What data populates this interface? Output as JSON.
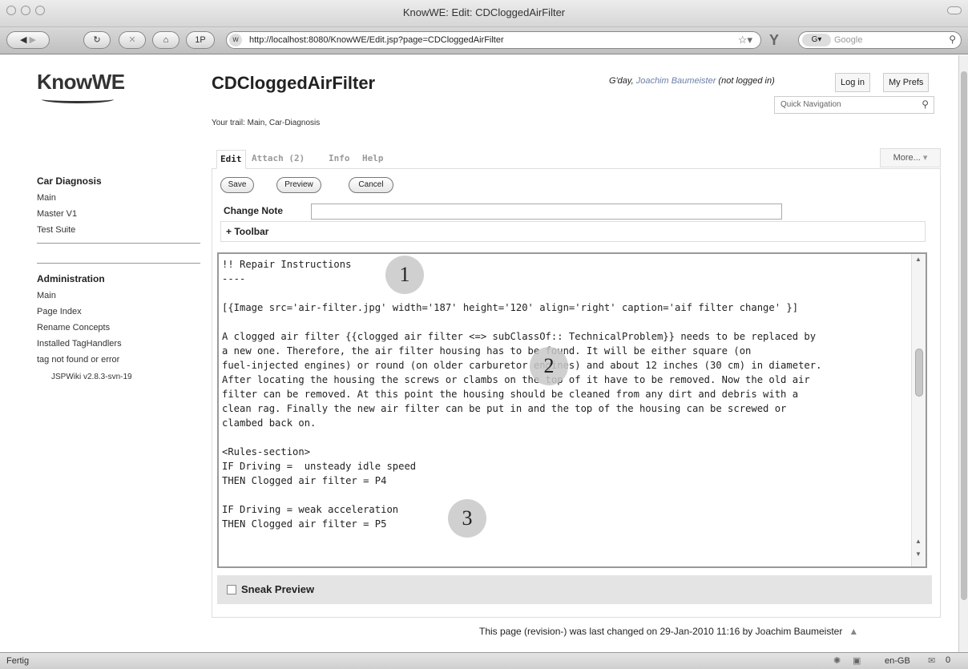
{
  "window": {
    "title": "KnowWE: Edit: CDCloggedAirFilter"
  },
  "browser": {
    "url": "http://localhost:8080/KnowWE/Edit.jsp?page=CDCloggedAirFilter",
    "search_placeholder": "Google",
    "onep_label": "1P",
    "back_icon": "back-arrow-icon",
    "reload_icon": "reload-icon",
    "stop_icon": "stop-icon",
    "home_icon": "home-icon"
  },
  "header": {
    "logo": "KnowWE",
    "page_title": "CDCloggedAirFilter",
    "trail": "Your trail: Main, Car-Diagnosis",
    "greeting_prefix": "G'day,",
    "user_name": "Joachim Baumeister",
    "greeting_suffix": "(not logged in)",
    "login_label": "Log in",
    "prefs_label": "My Prefs",
    "quick_nav_placeholder": "Quick Navigation"
  },
  "sidebar": {
    "section1_title": "Car Diagnosis",
    "section1_items": [
      "Main",
      "Master V1",
      "Test Suite"
    ],
    "section2_title": "Administration",
    "section2_items": [
      "Main",
      "Page Index",
      "Rename Concepts",
      "Installed TagHandlers",
      "tag not found or error"
    ],
    "version": "JSPWiki v2.8.3-svn-19"
  },
  "tabs": {
    "edit": "Edit",
    "attach": "Attach (2)",
    "info": "Info",
    "help": "Help",
    "more": "More..."
  },
  "edit_form": {
    "save_label": "Save",
    "preview_label": "Preview",
    "cancel_label": "Cancel",
    "change_note_label": "Change Note",
    "change_note_value": "",
    "toolbar_label": "+ Toolbar",
    "editor_lines": [
      "!! Repair Instructions",
      "----",
      "",
      "[{Image src='air-filter.jpg' width='187' height='120' align='right' caption='aif filter change' }]",
      "",
      "A clogged air filter {{clogged air filter <=> subClassOf:: TechnicalProblem}} needs to be replaced by",
      "a new one. Therefore, the air filter housing has to be found. It will be either square (on",
      "fuel-injected engines) or round (on older carburetor engines) and about 12 inches (30 cm) in diameter.",
      "After locating the housing the screws or clambs on the top of it have to be removed. Now the old air",
      "filter can be removed. At this point the housing should be cleaned from any dirt and debris with a",
      "clean rag. Finally the new air filter can be put in and the top of the housing can be screwed or",
      "clambed back on.",
      "",
      "<Rules-section>",
      "IF Driving =  unsteady idle speed",
      "THEN Clogged air filter = P4",
      "",
      "IF Driving = weak acceleration",
      "THEN Clogged air filter = P5"
    ],
    "markers": [
      "1",
      "2",
      "3"
    ],
    "sneak_preview_label": "Sneak Preview"
  },
  "footer": {
    "text": "This page (revision-) was last changed on 29-Jan-2010 11:16 by Joachim Baumeister"
  },
  "statusbar": {
    "status": "Fertig",
    "language": "en-GB",
    "counter": "0"
  }
}
